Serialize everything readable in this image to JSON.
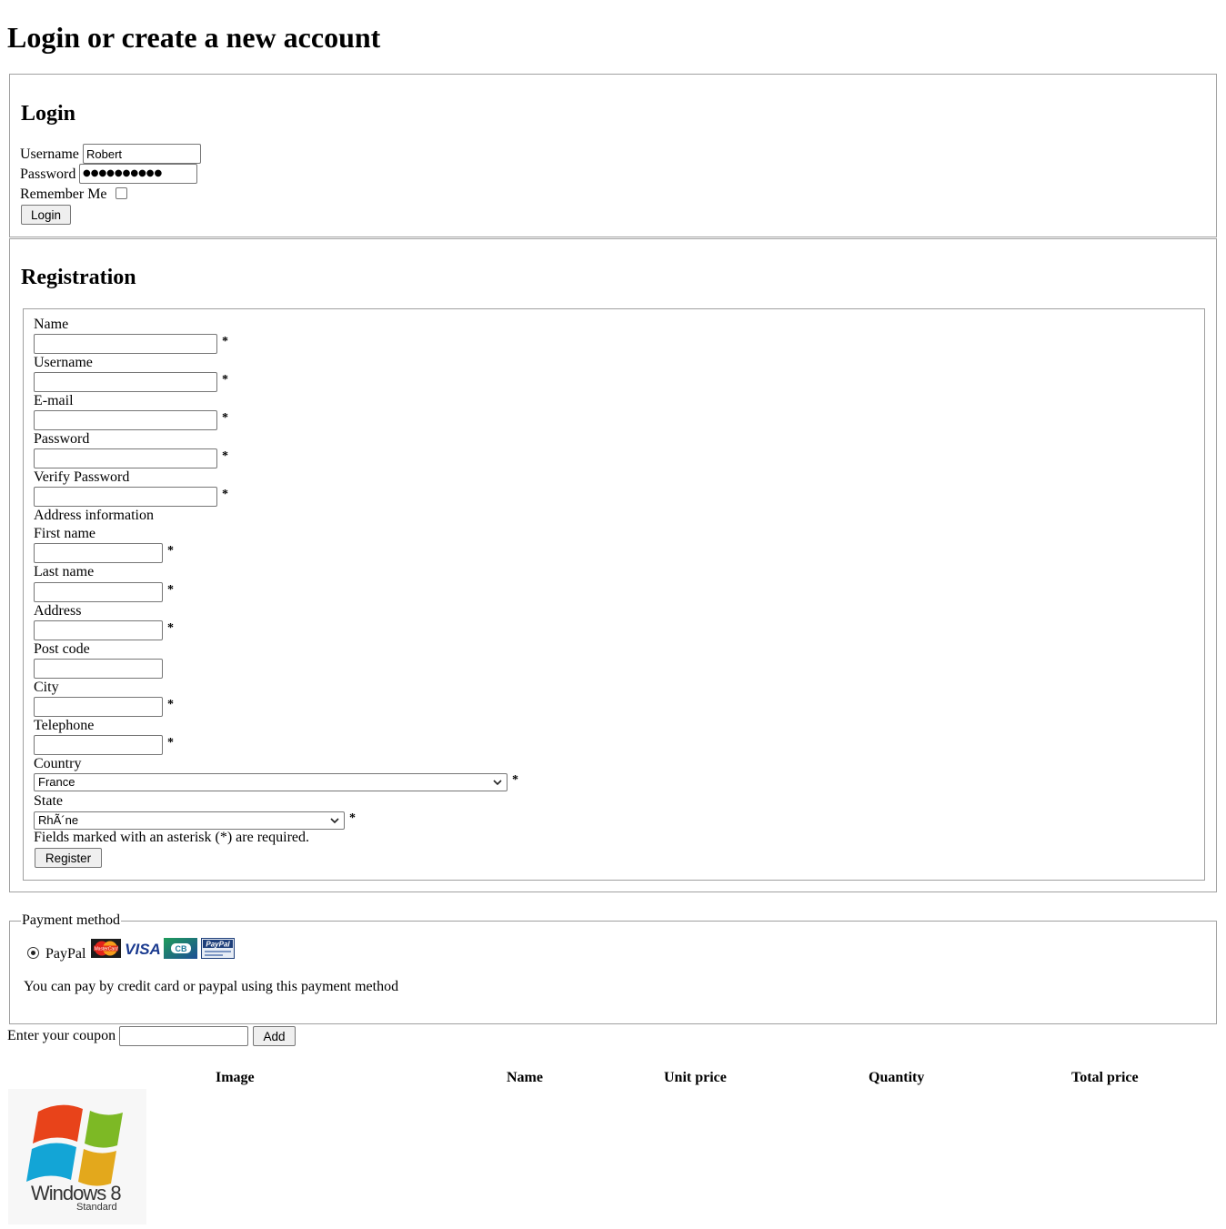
{
  "page": {
    "title": "Login or create a new account"
  },
  "login": {
    "heading": "Login",
    "username_label": "Username",
    "username_value": "Robert",
    "password_label": "Password",
    "password_value": "●●●●●●●●●●",
    "remember_label": "Remember Me",
    "remember_checked": false,
    "submit_label": "Login"
  },
  "registration": {
    "heading": "Registration",
    "name_label": "Name",
    "username_label": "Username",
    "email_label": "E-mail",
    "password_label": "Password",
    "verify_password_label": "Verify Password",
    "address_info_label": "Address information",
    "first_name_label": "First name",
    "last_name_label": "Last name",
    "address_label": "Address",
    "post_code_label": "Post code",
    "city_label": "City",
    "telephone_label": "Telephone",
    "country_label": "Country",
    "country_value": "France",
    "state_label": "State",
    "state_value": "RhÃ´ne",
    "required_marker": "*",
    "required_note": "Fields marked with an asterisk (*) are required.",
    "submit_label": "Register"
  },
  "payment": {
    "legend": "Payment method",
    "option_label": "PayPal",
    "option_selected": true,
    "card_icons": [
      "mastercard-icon",
      "visa-icon",
      "cb-icon",
      "paypal-icon"
    ],
    "card_icon_texts": {
      "mastercard": "MasterCard",
      "visa": "VISA",
      "cb": "CB",
      "paypal": "PayPal"
    },
    "description": "You can pay by credit card or paypal using this payment method"
  },
  "coupon": {
    "label": "Enter your coupon",
    "value": "",
    "add_label": "Add"
  },
  "cart": {
    "headers": [
      "Image",
      "Name",
      "Unit price",
      "Quantity",
      "Total price"
    ],
    "product_image": {
      "title": "Windows 8",
      "subtitle": "Standard"
    }
  },
  "colors": {
    "win_red": "#e8431a",
    "win_green": "#7db925",
    "win_blue": "#13a5d6",
    "win_yellow": "#e3a81c",
    "visa_blue": "#1a3a8f",
    "cb_teal": "#1d7a9a"
  }
}
